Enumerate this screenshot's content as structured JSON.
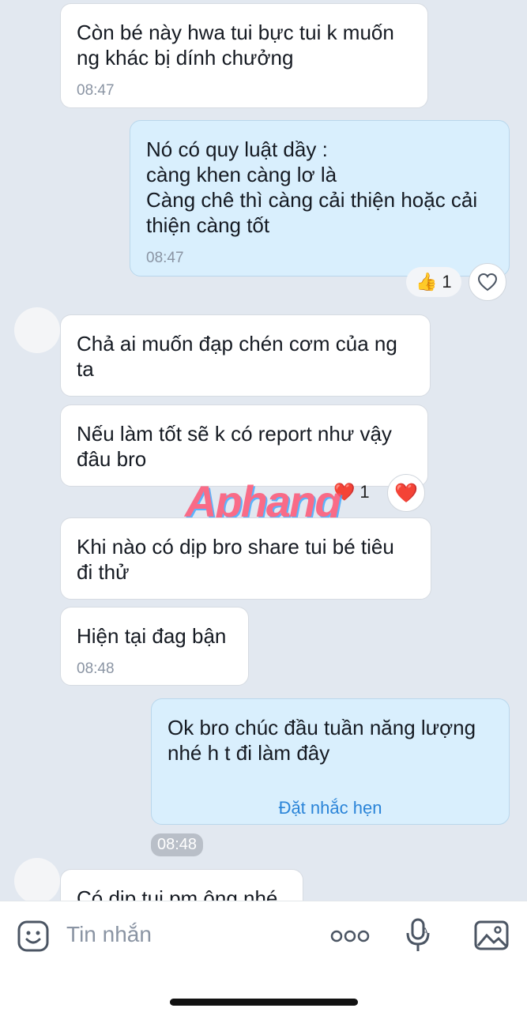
{
  "messages": [
    {
      "text": "Còn bé này hwa tui bực tui k muốn\nng khác bị dính chưởng",
      "time": "08:47"
    },
    {
      "text": "Nó có quy luật dầy :\ncàng khen càng lơ là\nCàng chê thì càng cải thiện hoặc cải\nthiện càng tốt",
      "time": "08:47",
      "reaction": {
        "emoji": "👍",
        "count": "1"
      }
    },
    {
      "text": "Chả ai muốn đạp chén cơm của ng\nta"
    },
    {
      "text": "Nếu làm tốt sẽ k có report như vậy\nđâu bro",
      "reaction": {
        "emoji": "❤️",
        "count": "1"
      }
    },
    {
      "text": "Khi nào có dịp bro share tui bé tiêu\nđi thử"
    },
    {
      "text": "Hiện tại đag bận",
      "time": "08:48"
    },
    {
      "text": "Ok bro chúc đầu tuần năng lượng\nnhé h t đi làm đây",
      "reminder": "Đặt nhắc hẹn"
    },
    {
      "text": "Có dịp tui pm ông nhé"
    }
  ],
  "chip_time": "08:48",
  "watermark": "Aphang",
  "input": {
    "placeholder": "Tin nhắn"
  },
  "icons": [
    "sticker-icon",
    "more-icon",
    "voice-to-text-icon",
    "image-icon",
    "heart-outline-icon"
  ]
}
